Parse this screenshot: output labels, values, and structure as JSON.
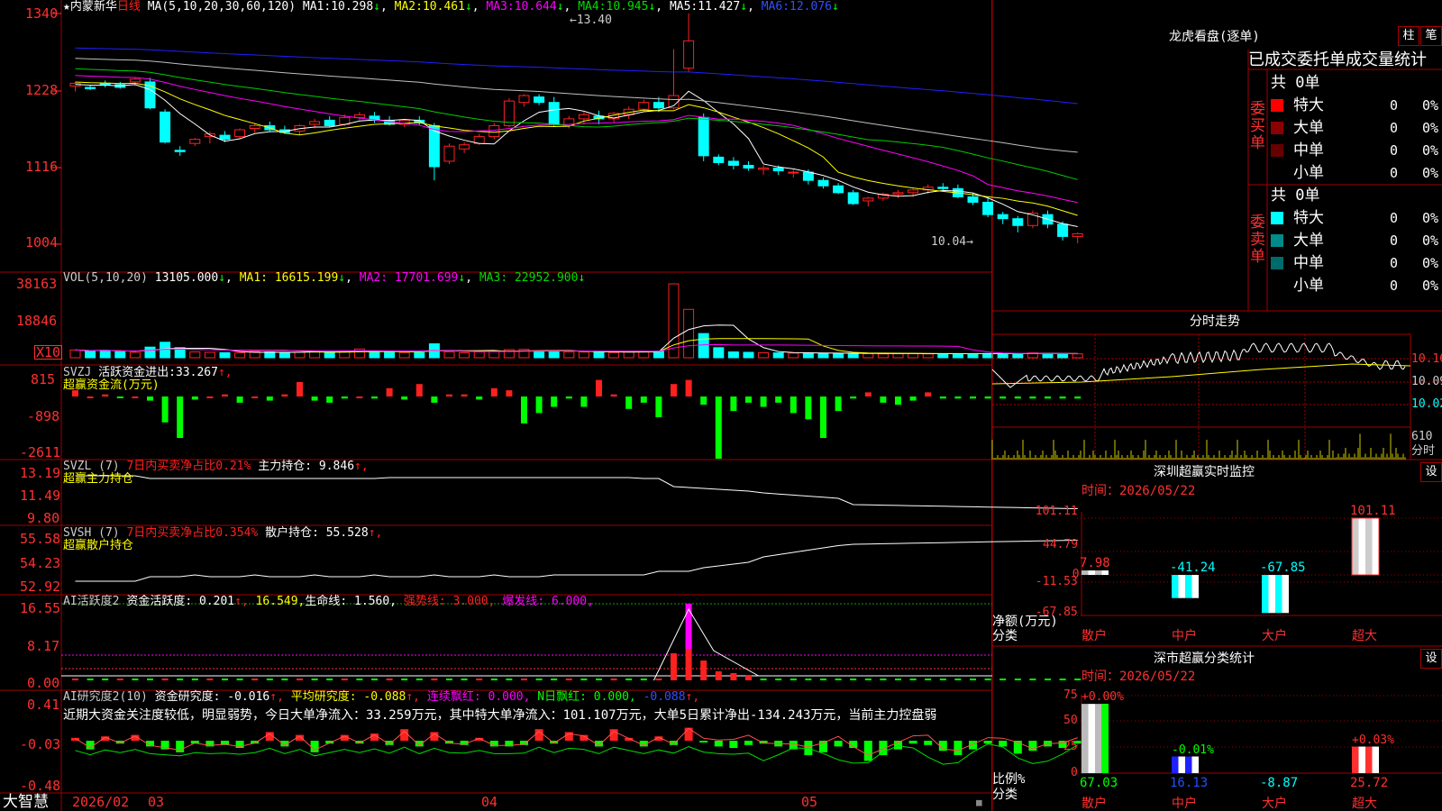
{
  "colors": {
    "up": "#ff2020",
    "down": "#00ffff",
    "bg": "#000000",
    "grid": "#8b0000",
    "ma1": "#ffffff",
    "ma2": "#ffff00",
    "ma3": "#ff00ff",
    "ma4": "#00cc00",
    "ma5": "#c0c0c0",
    "ma6": "#2020ff",
    "green": "#00ff00"
  },
  "kline": {
    "title_star": "★",
    "name": "内蒙新华",
    "period": "日线",
    "ma_label": "MA(5,10,20,30,60,120)",
    "ma": [
      {
        "label": "MA1:",
        "value": "10.298",
        "arrow": "↓"
      },
      {
        "label": "MA2:",
        "value": "10.461",
        "arrow": "↓"
      },
      {
        "label": "MA3:",
        "value": "10.644",
        "arrow": "↓"
      },
      {
        "label": "MA4:",
        "value": "10.945",
        "arrow": "↓"
      },
      {
        "label": "MA5:",
        "value": "11.427",
        "arrow": "↓"
      },
      {
        "label": "MA6:",
        "value": "12.076",
        "arrow": "↓"
      }
    ],
    "yticks": [
      "1340",
      "1228",
      "1116",
      "1004"
    ],
    "high_label": "13.40",
    "low_label": "10.04"
  },
  "volume": {
    "label": "VOL(5,10,20)",
    "value": "13105.000",
    "arrow0": "↓",
    "ma": [
      {
        "label": "MA1:",
        "value": "16615.199",
        "arrow": "↓"
      },
      {
        "label": "MA2:",
        "value": "17701.699",
        "arrow": "↓"
      },
      {
        "label": "MA3:",
        "value": "22952.900",
        "arrow": "↓"
      }
    ],
    "yticks": [
      "38163",
      "18846"
    ],
    "unit": "X10"
  },
  "svzj": {
    "label": "SVZJ",
    "desc": "活跃资金进出:",
    "value": "33.267",
    "arrow": "↑,",
    "sub": "超赢资金流(万元)",
    "yticks": [
      "815",
      "-898",
      "-2611"
    ]
  },
  "svzl": {
    "label": "SVZL (7)",
    "desc": "7日内买卖净占比0.21%",
    "desc2": "主力持仓:",
    "value": "9.846",
    "arrow": "↑,",
    "sub": "超赢主力持仓",
    "yticks": [
      "13.19",
      "11.49",
      "9.80"
    ]
  },
  "svsh": {
    "label": "SVSH (7)",
    "desc": "7日内买卖净占比0.354%",
    "desc2": "散户持仓:",
    "value": "55.528",
    "arrow": "↑,",
    "sub": "超赢散户持仓",
    "yticks": [
      "55.58",
      "54.23",
      "52.92"
    ]
  },
  "ai1": {
    "label": "AI活跃度2",
    "d1": "资金活跃度:",
    "v1": "0.201",
    "a1": "↑,",
    "v2": "16.549,",
    "d3": "生命线:",
    "v3": "1.560,",
    "d4": "强势线:",
    "v4": "3.000,",
    "d5": "爆发线:",
    "v5": "6.000,",
    "yticks": [
      "16.55",
      "8.17",
      "0.00"
    ]
  },
  "ai2": {
    "label": "AI研究度2(10)",
    "d1": "资金研究度:",
    "v1": "-0.016",
    "a1": "↑,",
    "d2": "平均研究度:",
    "v2": "-0.088",
    "a2": "↑,",
    "d3": "连续飘红:",
    "v3": "0.000,",
    "d4": "N日飘红:",
    "v4": "0.000,",
    "v5": "-0.088",
    "a5": "↑,",
    "comment": "近期大资金关注度较低，明显弱势，今日大单净流入：33.259万元，其中特大单净流入：101.107万元，大单5日累计净出-134.243万元，当前主力控盘弱",
    "yticks": [
      "0.41",
      "-0.03",
      "-0.48"
    ]
  },
  "xaxis": {
    "brand": "大智慧",
    "labels": [
      "2026/02",
      "03",
      "04",
      "05"
    ]
  },
  "lhb": {
    "title": "龙虎看盘(逐单)",
    "btn1": "柱",
    "btn2": "笔",
    "header": "已成交委托单成交量统计",
    "buy": {
      "side": "委买单",
      "count": "共 0单",
      "rows": [
        {
          "name": "特大",
          "v": "0",
          "p": "0%"
        },
        {
          "name": "大单",
          "v": "0",
          "p": "0%"
        },
        {
          "name": "中单",
          "v": "0",
          "p": "0%"
        },
        {
          "name": "小单",
          "v": "0",
          "p": "0%"
        }
      ]
    },
    "sell": {
      "side": "委卖单",
      "count": "共 0单",
      "rows": [
        {
          "name": "特大",
          "v": "0",
          "p": "0%"
        },
        {
          "name": "大单",
          "v": "0",
          "p": "0%"
        },
        {
          "name": "中单",
          "v": "0",
          "p": "0%"
        },
        {
          "name": "小单",
          "v": "0",
          "p": "0%"
        }
      ]
    }
  },
  "intraday": {
    "title": "分时走势",
    "yticks": [
      "10.16",
      "10.09",
      "10.02"
    ],
    "vol_tick": "610",
    "vol_label": "分时"
  },
  "monitor": {
    "title": "深圳超赢实时监控",
    "btn": "设",
    "date_label": "时间：2026/05/22",
    "yticks": [
      "101.11",
      "44.79",
      "0",
      "-11.53",
      "-67.85"
    ],
    "axis_label1": "净额(万元)",
    "axis_label2": "分类",
    "categories": [
      "散户",
      "中户",
      "大户",
      "超大"
    ],
    "values": [
      "7.98",
      "-41.24",
      "-67.85",
      "101.11"
    ]
  },
  "classify": {
    "title": "深市超赢分类统计",
    "btn": "设",
    "date_label": "时间：2026/05/22",
    "yticks": [
      "75",
      "50",
      "25",
      "0"
    ],
    "axis_label1": "比例%",
    "axis_label2": "分类",
    "categories": [
      "散户",
      "中户",
      "大户",
      "超大"
    ],
    "top_labels": [
      "+0.00%",
      "-0.01%",
      "",
      "+0.03%"
    ],
    "values": [
      "67.03",
      "16.13",
      "-8.87",
      "25.72"
    ]
  },
  "chart_data": {
    "type": "candlestick",
    "title": "内蒙新华 日线",
    "x_axis_labels": [
      "2026/02",
      "03",
      "04",
      "05"
    ],
    "ylim": [
      1004,
      1340
    ],
    "ohlc": [
      [
        1234,
        1240,
        1226,
        1238
      ],
      [
        1232,
        1236,
        1228,
        1230
      ],
      [
        1238,
        1242,
        1232,
        1236
      ],
      [
        1236,
        1240,
        1230,
        1232
      ],
      [
        1240,
        1246,
        1234,
        1244
      ],
      [
        1240,
        1246,
        1200,
        1202
      ],
      [
        1196,
        1200,
        1150,
        1152
      ],
      [
        1140,
        1146,
        1132,
        1138
      ],
      [
        1150,
        1158,
        1146,
        1156
      ],
      [
        1160,
        1168,
        1150,
        1164
      ],
      [
        1162,
        1168,
        1152,
        1156
      ],
      [
        1160,
        1172,
        1156,
        1170
      ],
      [
        1172,
        1180,
        1166,
        1176
      ],
      [
        1176,
        1182,
        1168,
        1170
      ],
      [
        1170,
        1176,
        1164,
        1166
      ],
      [
        1168,
        1178,
        1162,
        1176
      ],
      [
        1178,
        1186,
        1172,
        1182
      ],
      [
        1184,
        1190,
        1174,
        1176
      ],
      [
        1178,
        1192,
        1176,
        1188
      ],
      [
        1188,
        1196,
        1184,
        1192
      ],
      [
        1190,
        1196,
        1180,
        1184
      ],
      [
        1184,
        1190,
        1176,
        1178
      ],
      [
        1178,
        1186,
        1174,
        1184
      ],
      [
        1184,
        1190,
        1176,
        1180
      ],
      [
        1176,
        1180,
        1096,
        1116
      ],
      [
        1124,
        1150,
        1120,
        1146
      ],
      [
        1142,
        1152,
        1136,
        1148
      ],
      [
        1150,
        1164,
        1148,
        1160
      ],
      [
        1160,
        1180,
        1156,
        1176
      ],
      [
        1176,
        1216,
        1174,
        1212
      ],
      [
        1210,
        1222,
        1204,
        1220
      ],
      [
        1218,
        1222,
        1206,
        1210
      ],
      [
        1210,
        1218,
        1174,
        1178
      ],
      [
        1176,
        1190,
        1172,
        1186
      ],
      [
        1186,
        1196,
        1178,
        1192
      ],
      [
        1190,
        1198,
        1178,
        1186
      ],
      [
        1186,
        1196,
        1180,
        1194
      ],
      [
        1192,
        1204,
        1186,
        1200
      ],
      [
        1200,
        1214,
        1196,
        1210
      ],
      [
        1210,
        1218,
        1196,
        1202
      ],
      [
        1202,
        1288,
        1200,
        1220
      ],
      [
        1260,
        1340,
        1254,
        1300
      ],
      [
        1188,
        1194,
        1124,
        1132
      ],
      [
        1130,
        1134,
        1118,
        1122
      ],
      [
        1124,
        1130,
        1112,
        1118
      ],
      [
        1118,
        1124,
        1110,
        1114
      ],
      [
        1112,
        1118,
        1104,
        1114
      ],
      [
        1114,
        1118,
        1104,
        1110
      ],
      [
        1108,
        1112,
        1100,
        1108
      ],
      [
        1108,
        1112,
        1090,
        1096
      ],
      [
        1096,
        1100,
        1084,
        1088
      ],
      [
        1088,
        1092,
        1076,
        1078
      ],
      [
        1078,
        1082,
        1060,
        1062
      ],
      [
        1066,
        1072,
        1058,
        1070
      ],
      [
        1070,
        1078,
        1066,
        1076
      ],
      [
        1076,
        1082,
        1070,
        1078
      ],
      [
        1078,
        1084,
        1072,
        1082
      ],
      [
        1082,
        1090,
        1076,
        1086
      ],
      [
        1086,
        1092,
        1080,
        1084
      ],
      [
        1084,
        1090,
        1070,
        1072
      ],
      [
        1072,
        1078,
        1060,
        1064
      ],
      [
        1064,
        1070,
        1042,
        1046
      ],
      [
        1046,
        1050,
        1032,
        1040
      ],
      [
        1040,
        1044,
        1020,
        1030
      ],
      [
        1030,
        1052,
        1026,
        1048
      ],
      [
        1046,
        1052,
        1026,
        1032
      ],
      [
        1032,
        1036,
        1008,
        1014
      ],
      [
        1014,
        1020,
        1004,
        1018
      ]
    ]
  }
}
